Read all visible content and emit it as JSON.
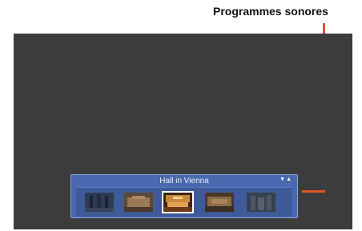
{
  "callout": {
    "label": "Programmes sonores"
  },
  "panel": {
    "title": "Hall in Vienna",
    "arrows_icon": "up-down-arrows-icon",
    "thumbnails": [
      {
        "name": "sound-program-1",
        "selected": false
      },
      {
        "name": "sound-program-2",
        "selected": false
      },
      {
        "name": "sound-program-3",
        "selected": true
      },
      {
        "name": "sound-program-4",
        "selected": false
      },
      {
        "name": "sound-program-5",
        "selected": false
      }
    ]
  },
  "colors": {
    "screen_bg": "#3c3c3c",
    "panel_bg": "#4a68b0",
    "callout_line": "#e0562a"
  }
}
